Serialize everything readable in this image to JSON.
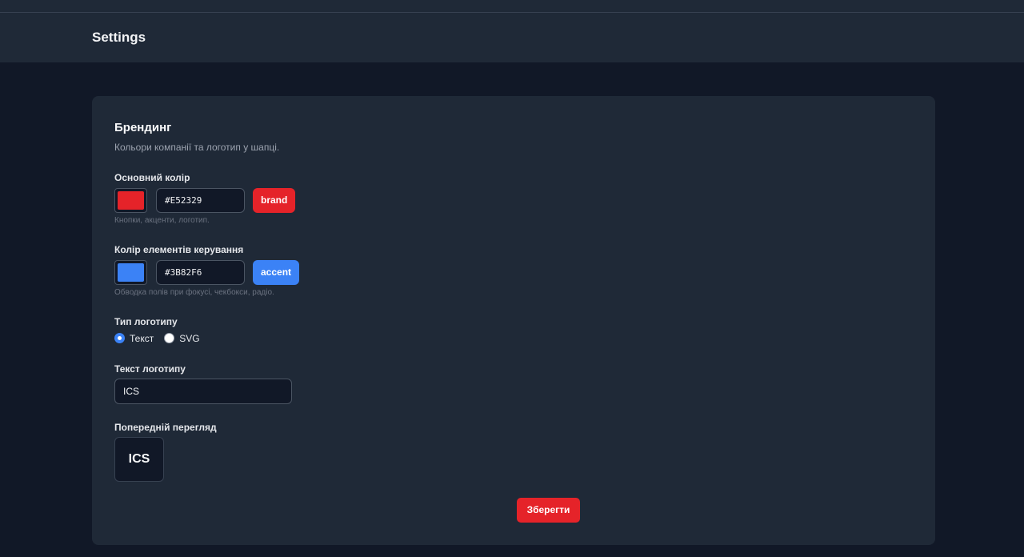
{
  "header": {
    "title": "Settings"
  },
  "branding": {
    "title": "Брендинг",
    "description": "Кольори компанії та логотип у шапці.",
    "primary": {
      "label": "Основний колір",
      "hex": "#E52329",
      "tag": "brand",
      "hint": "Кнопки, акценти, логотип."
    },
    "control": {
      "label": "Колір елементів керування",
      "hex": "#3B82F6",
      "tag": "accent",
      "hint": "Обводка полів при фокусі, чекбокси, радіо."
    },
    "logo_type": {
      "label": "Тип логотипу",
      "options": [
        {
          "label": "Текст",
          "selected": true
        },
        {
          "label": "SVG",
          "selected": false
        }
      ]
    },
    "logo_text": {
      "label": "Текст логотипу",
      "value": "ICS"
    },
    "preview": {
      "label": "Попередній перегляд",
      "text": "ICS"
    },
    "save_label": "Зберегти"
  },
  "colors": {
    "background": "#111827",
    "card": "#1f2937",
    "brand": "#E52329",
    "accent": "#3B82F6"
  }
}
